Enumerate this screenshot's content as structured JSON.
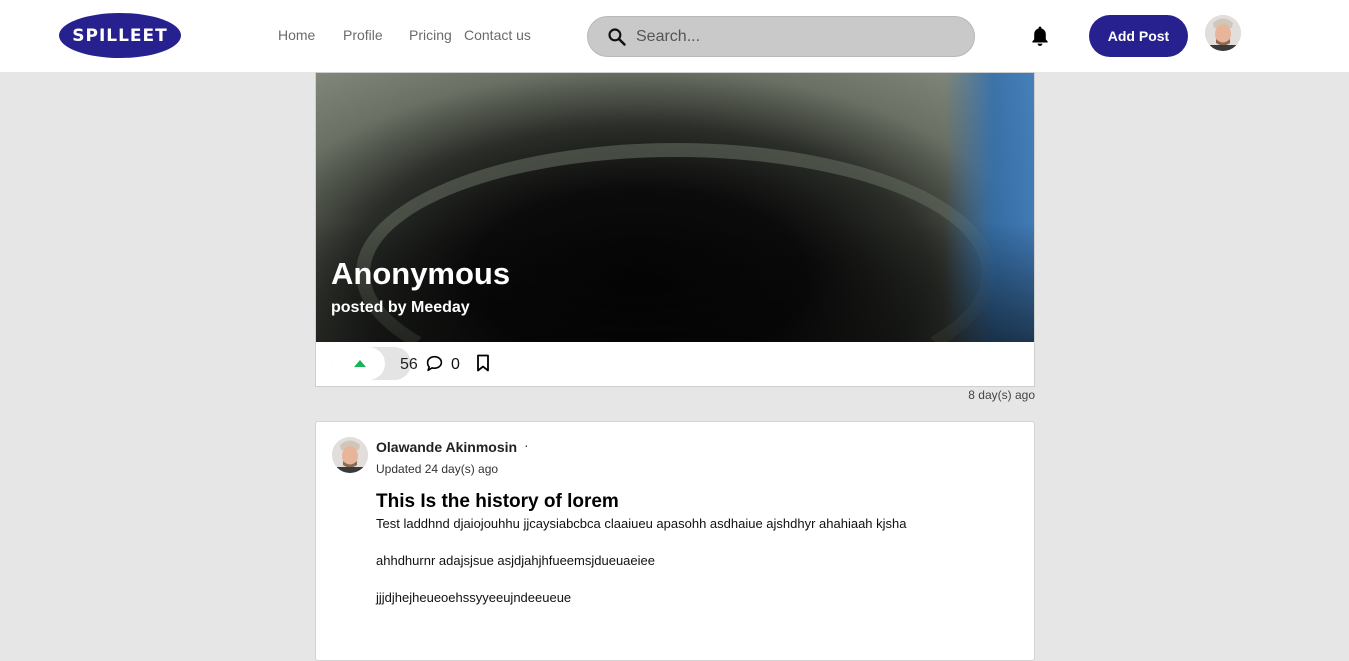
{
  "header": {
    "logo_text": "SPILLEET",
    "nav": [
      "Home",
      "Profile",
      "Pricing",
      "Contact us"
    ],
    "search_placeholder": "Search...",
    "add_post_label": "Add Post",
    "icons": {
      "search": "search-icon",
      "notifications": "bell-icon"
    }
  },
  "featured_post": {
    "title": "Anonymous",
    "byline": "posted by Meeday",
    "votes": "56",
    "comments": "0",
    "time_ago": "8 day(s) ago"
  },
  "post": {
    "author": "Olawande Akinmosin",
    "separator": "·",
    "updated": "Updated 24 day(s) ago",
    "title": "This Is the history of lorem",
    "body": [
      "Test laddhnd djaiojouhhu jjcaysiabcbca claaiueu apasohh asdhaiue ajshdhyr ahahiaah kjsha",
      "ahhdhurnr adajsjsue asjdjahjhfueemsjdueuaeiee",
      "jjjdjhejheueoehssyyeeujndeeueue"
    ]
  },
  "colors": {
    "brand": "#27208f",
    "upvote": "#19b35a",
    "background": "#e6e6e6"
  }
}
